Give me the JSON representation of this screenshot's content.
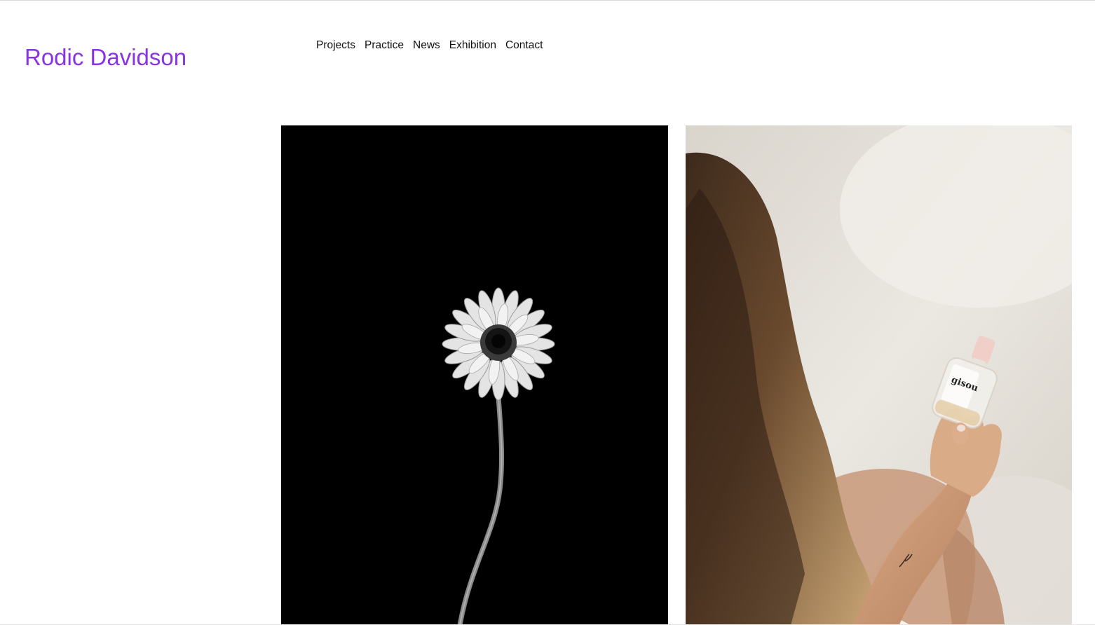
{
  "site": {
    "logo": "Rodic Davidson",
    "logo_color": "#8a34e0"
  },
  "nav": {
    "items": [
      {
        "label": "Projects"
      },
      {
        "label": "Practice"
      },
      {
        "label": "News"
      },
      {
        "label": "Exhibition"
      },
      {
        "label": "Contact"
      }
    ]
  },
  "gallery": {
    "images": [
      {
        "subject": "black-and-white gerbera daisy on black background"
      },
      {
        "subject": "woman with long hair holding a perfume bottle"
      }
    ],
    "bottle_label": "gisou"
  }
}
